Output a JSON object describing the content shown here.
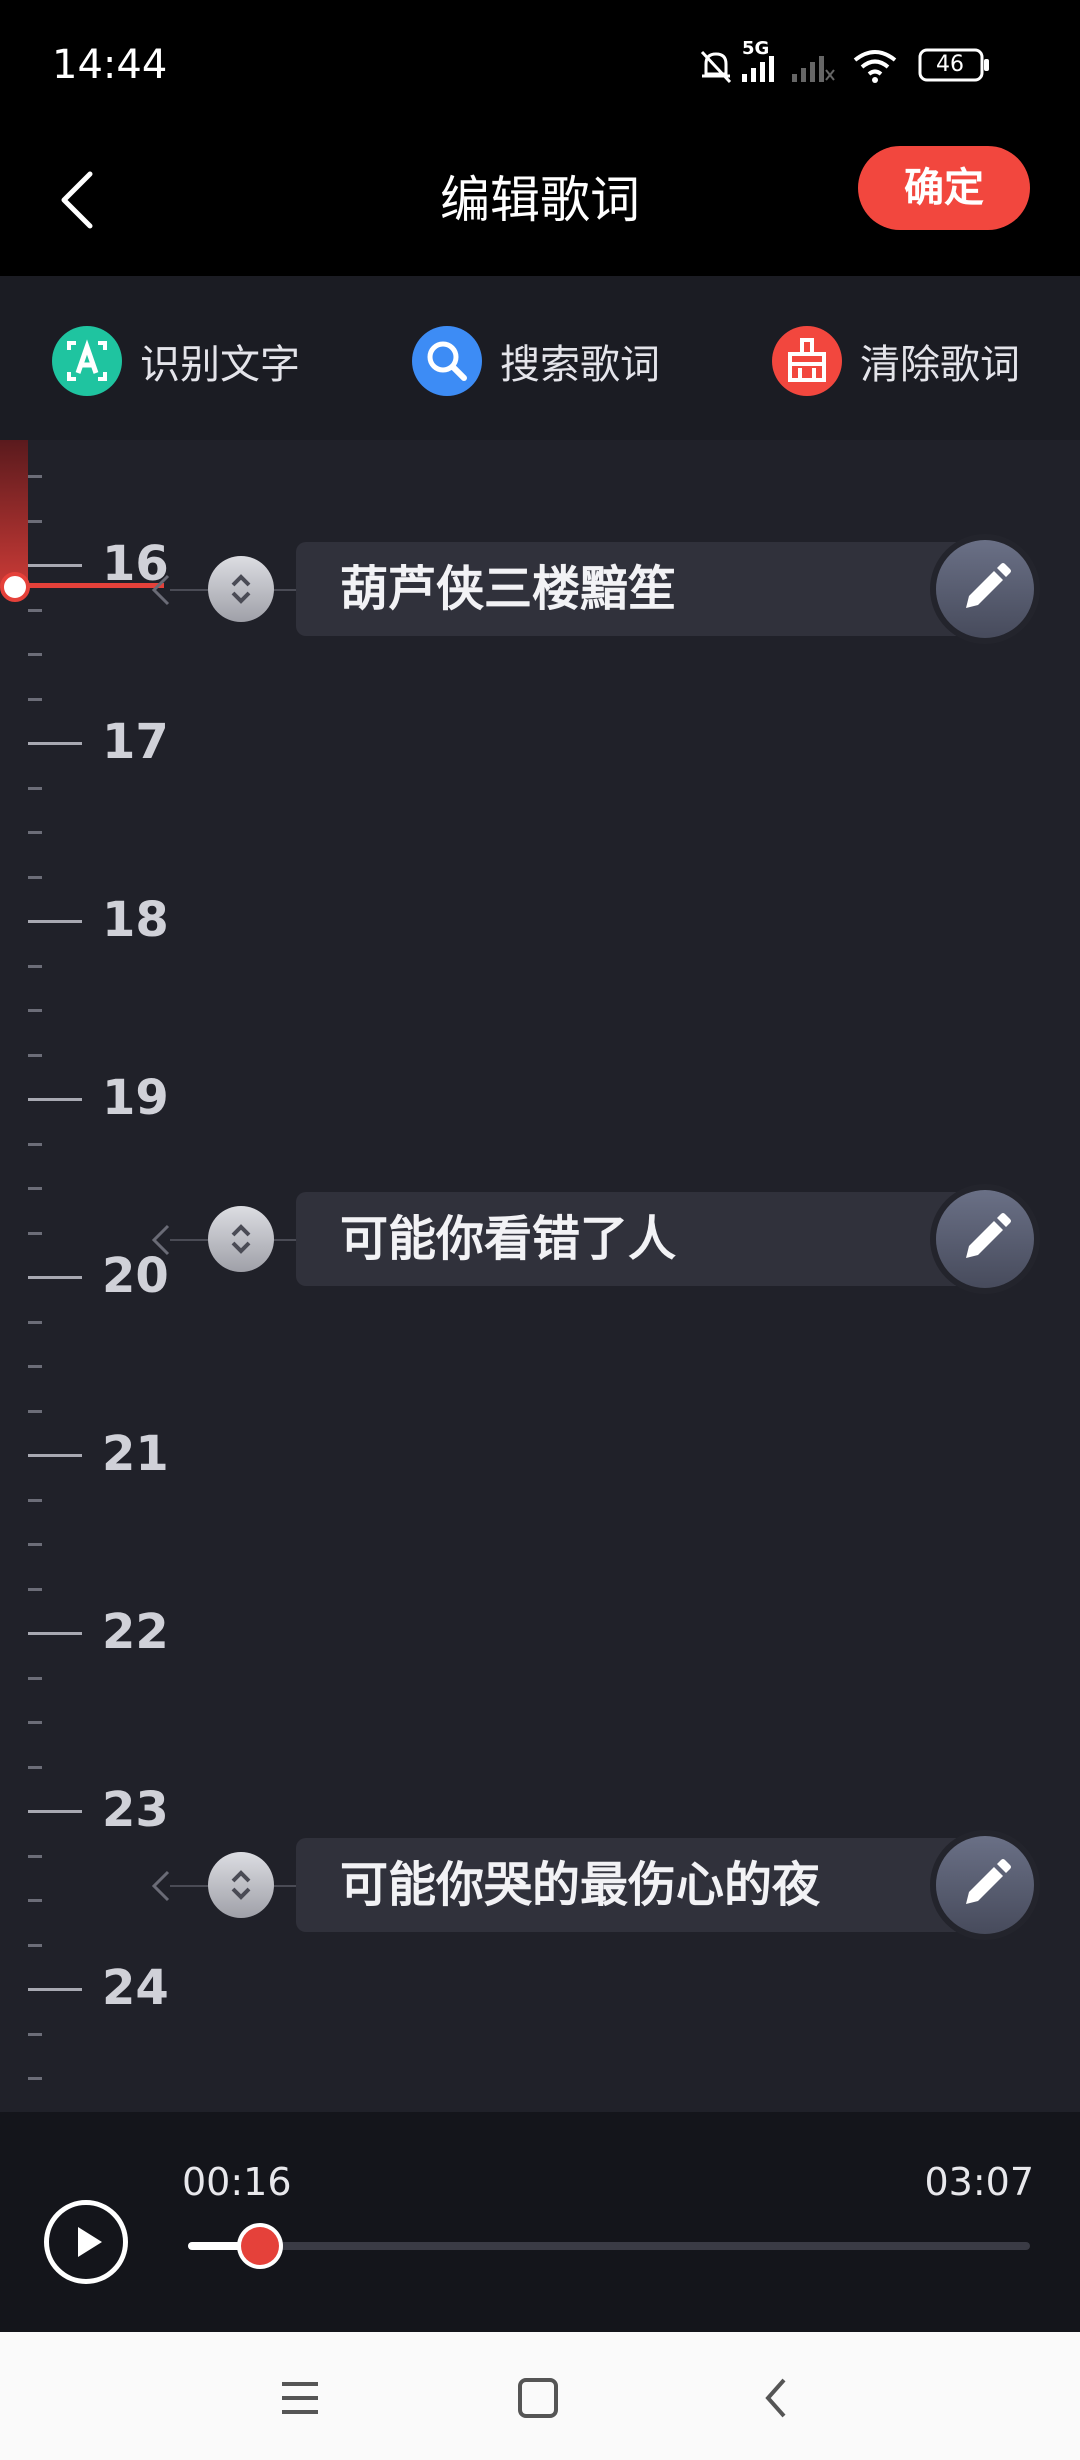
{
  "status": {
    "time": "14:44",
    "network": "5G",
    "battery": "46"
  },
  "header": {
    "title": "编辑歌词",
    "confirm_label": "确定"
  },
  "toolbar": {
    "items": [
      {
        "label": "识别文字",
        "icon": "text-recognize-icon",
        "color": "#1fc4a0"
      },
      {
        "label": "搜索歌词",
        "icon": "search-icon",
        "color": "#3d8cf5"
      },
      {
        "label": "清除歌词",
        "icon": "broom-clear-icon",
        "color": "#f2473e"
      }
    ]
  },
  "timeline": {
    "labels": [
      "16",
      "17",
      "18",
      "19",
      "20",
      "21",
      "22",
      "23",
      "24"
    ]
  },
  "lyrics": [
    {
      "text": "葫芦侠三楼黯笙"
    },
    {
      "text": "可能你看错了人"
    },
    {
      "text": "可能你哭的最伤心的夜"
    }
  ],
  "player": {
    "current_time": "00:16",
    "total_time": "03:07",
    "progress": 0.085
  },
  "colors": {
    "accent": "#f2473e",
    "background": "#202129"
  }
}
